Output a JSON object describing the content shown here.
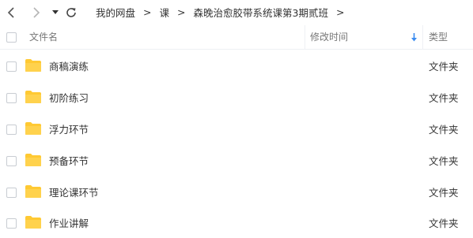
{
  "breadcrumb": [
    "我的网盘",
    "课",
    "森晚治愈胶带系统课第3期贰班"
  ],
  "breadcrumb_separator": ">",
  "columns": {
    "name": "文件名",
    "modified": "修改时间",
    "type": "类型"
  },
  "colors": {
    "folder": "#ffc933",
    "sort_arrow": "#3b8cf0"
  },
  "files": [
    {
      "name": "商稿演练",
      "type": "文件夹",
      "icon": "folder-icon"
    },
    {
      "name": "初阶练习",
      "type": "文件夹",
      "icon": "folder-icon"
    },
    {
      "name": "浮力环节",
      "type": "文件夹",
      "icon": "folder-icon"
    },
    {
      "name": "预备环节",
      "type": "文件夹",
      "icon": "folder-icon"
    },
    {
      "name": "理论课环节",
      "type": "文件夹",
      "icon": "folder-icon"
    },
    {
      "name": "作业讲解",
      "type": "文件夹",
      "icon": "folder-icon"
    }
  ]
}
